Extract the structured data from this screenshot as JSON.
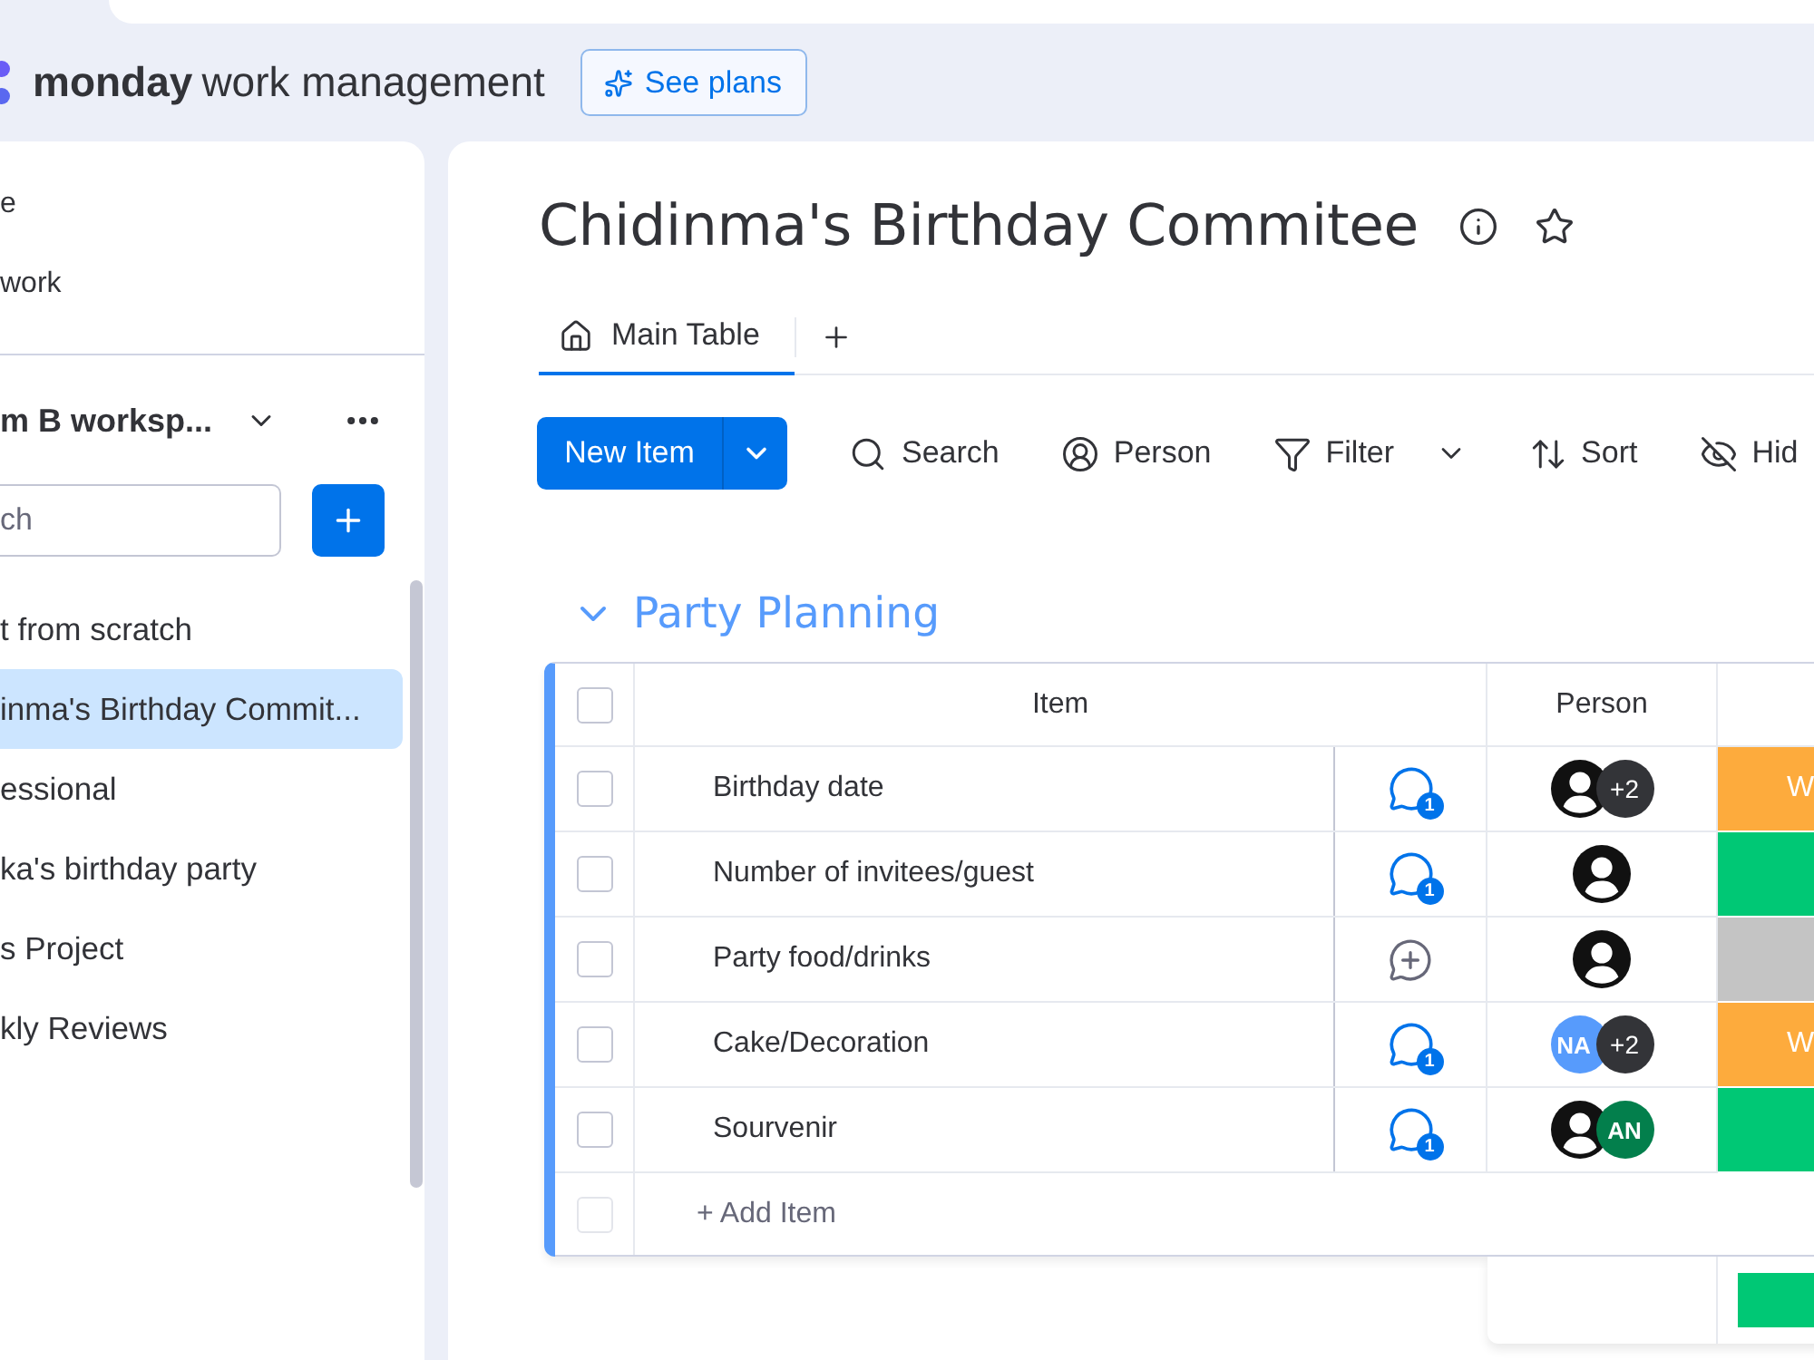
{
  "header": {
    "brand": "monday",
    "product": "work management",
    "plans_button": "See plans"
  },
  "sidebar": {
    "nav": [
      {
        "label": "e"
      },
      {
        "label": "work"
      }
    ],
    "workspace": "m B worksp...",
    "search": {
      "placeholder": "ch"
    },
    "boards": [
      {
        "label": "t from scratch",
        "selected": false
      },
      {
        "label": "inma's Birthday Commit...",
        "selected": true
      },
      {
        "label": "essional",
        "selected": false
      },
      {
        "label": "ka's birthday party",
        "selected": false
      },
      {
        "label": "s Project",
        "selected": false
      },
      {
        "label": "kly Reviews",
        "selected": false
      }
    ]
  },
  "board": {
    "title": "Chidinma's Birthday Commitee",
    "tabs": [
      {
        "label": "Main Table",
        "selected": true
      }
    ],
    "new_item_button": "New Item",
    "toolbar": [
      {
        "kind": "search",
        "label": "Search",
        "dropdown": false
      },
      {
        "kind": "person",
        "label": "Person",
        "dropdown": false
      },
      {
        "kind": "filter",
        "label": "Filter",
        "dropdown": true
      },
      {
        "kind": "sort",
        "label": "Sort",
        "dropdown": false
      },
      {
        "kind": "hide",
        "label": "Hid",
        "dropdown": false
      }
    ],
    "group": {
      "title": "Party Planning",
      "expanded": true,
      "select_all": false,
      "columns": [
        {
          "kind": "item",
          "label": "Item"
        },
        {
          "kind": "person",
          "label": "Person"
        }
      ],
      "rows": [
        {
          "name": "Birthday date",
          "checked": false,
          "updates": "1",
          "people": [
            {
              "kind": "silhouette"
            },
            {
              "kind": "more",
              "label": "+2"
            }
          ],
          "status": {
            "label": "W",
            "color": "#fdab3d"
          }
        },
        {
          "name": "Number of invitees/guest",
          "checked": false,
          "updates": "1",
          "people": [
            {
              "kind": "silhouette"
            }
          ],
          "status": {
            "color": "#00c875"
          }
        },
        {
          "name": "Party food/drinks",
          "checked": false,
          "people": [
            {
              "kind": "silhouette"
            }
          ],
          "status": {
            "color": "#c4c4c4"
          }
        },
        {
          "name": "Cake/Decoration",
          "checked": false,
          "updates": "1",
          "people": [
            {
              "kind": "initials",
              "label": "NA",
              "color": "#579bfc"
            },
            {
              "kind": "more",
              "label": "+2"
            }
          ],
          "status": {
            "label": "W",
            "color": "#fdab3d"
          }
        },
        {
          "name": "Sourvenir",
          "checked": false,
          "updates": "1",
          "people": [
            {
              "kind": "silhouette"
            },
            {
              "kind": "initials",
              "label": "AN",
              "color": "#037f4c"
            }
          ],
          "status": {
            "color": "#00c875"
          }
        }
      ],
      "add_item": {
        "label": "+ Add Item",
        "checked": false
      }
    }
  }
}
